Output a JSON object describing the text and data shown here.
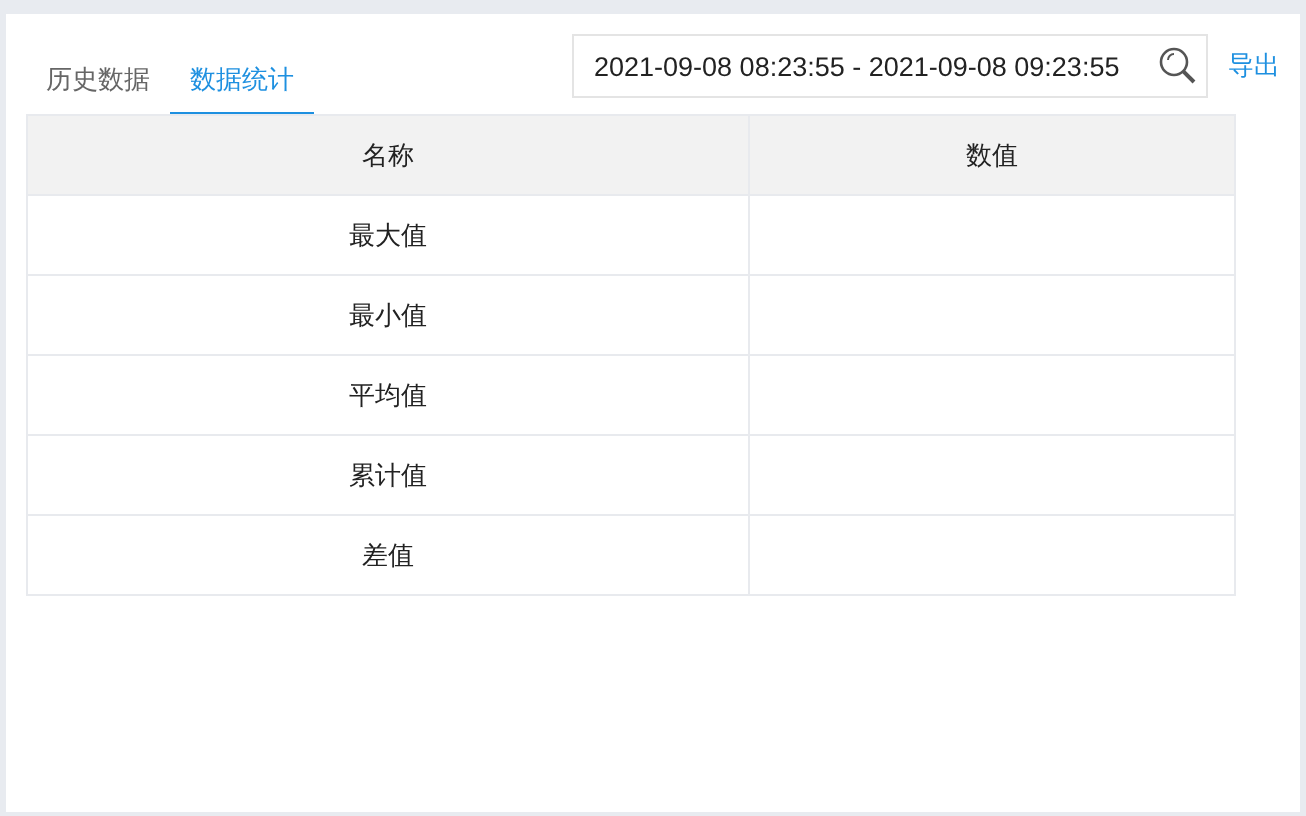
{
  "tabs": [
    {
      "label": "历史数据",
      "selected": false
    },
    {
      "label": "数据统计",
      "selected": true
    }
  ],
  "date_range": {
    "value": "2021-09-08 08:23:55 - 2021-09-08 09:23:55"
  },
  "export_link": "导出",
  "table": {
    "columns": [
      "名称",
      "数值"
    ],
    "rows": [
      {
        "name": "最大值"
      },
      {
        "name": "最小值"
      },
      {
        "name": "平均值"
      },
      {
        "name": "累计值"
      },
      {
        "name": "差值"
      }
    ]
  }
}
